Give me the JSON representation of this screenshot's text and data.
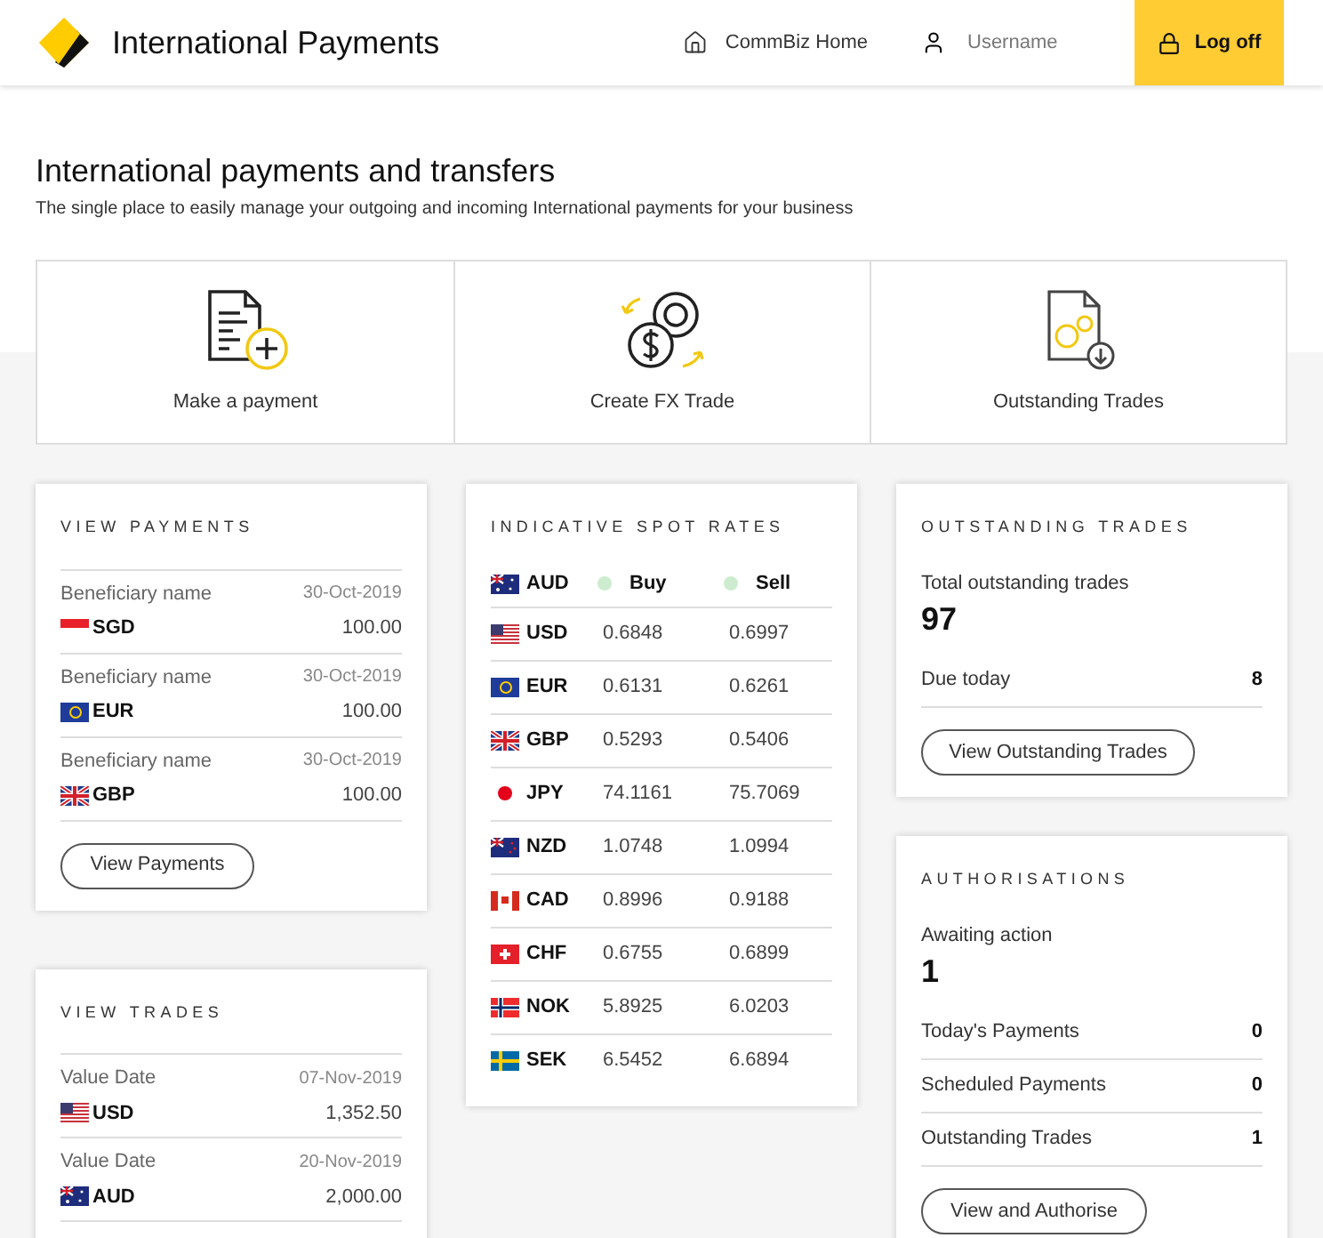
{
  "header": {
    "title": "International Payments",
    "home_link": "CommBiz Home",
    "username": "Username",
    "logoff": "Log off"
  },
  "intro": {
    "heading": "International payments and transfers",
    "subtitle": "The single place to easily manage your outgoing and incoming International payments for your business"
  },
  "actions": [
    {
      "kind": "payment",
      "label": "Make a payment"
    },
    {
      "kind": "fx",
      "label": "Create FX Trade"
    },
    {
      "kind": "outstanding",
      "label": "Outstanding Trades"
    }
  ],
  "view_payments": {
    "title": "VIEW PAYMENTS",
    "rows": [
      {
        "label": "Beneficiary name",
        "date": "30-Oct-2019",
        "currency": "SGD",
        "amount": "100.00"
      },
      {
        "label": "Beneficiary name",
        "date": "30-Oct-2019",
        "currency": "EUR",
        "amount": "100.00"
      },
      {
        "label": "Beneficiary name",
        "date": "30-Oct-2019",
        "currency": "GBP",
        "amount": "100.00"
      }
    ],
    "button": "View Payments"
  },
  "view_trades": {
    "title": "VIEW TRADES",
    "rows": [
      {
        "label": "Value Date",
        "date": "07-Nov-2019",
        "currency": "USD",
        "amount": "1,352.50"
      },
      {
        "label": "Value Date",
        "date": "20-Nov-2019",
        "currency": "AUD",
        "amount": "2,000.00"
      }
    ]
  },
  "spot_rates": {
    "title": "INDICATIVE SPOT RATES",
    "base": "AUD",
    "buy": "Buy",
    "sell": "Sell",
    "rows": [
      {
        "currency": "USD",
        "buy": "0.6848",
        "sell": "0.6997"
      },
      {
        "currency": "EUR",
        "buy": "0.6131",
        "sell": "0.6261"
      },
      {
        "currency": "GBP",
        "buy": "0.5293",
        "sell": "0.5406"
      },
      {
        "currency": "JPY",
        "buy": "74.1161",
        "sell": "75.7069"
      },
      {
        "currency": "NZD",
        "buy": "1.0748",
        "sell": "1.0994"
      },
      {
        "currency": "CAD",
        "buy": "0.8996",
        "sell": "0.9188"
      },
      {
        "currency": "CHF",
        "buy": "0.6755",
        "sell": "0.6899"
      },
      {
        "currency": "NOK",
        "buy": "5.8925",
        "sell": "6.0203"
      },
      {
        "currency": "SEK",
        "buy": "6.5452",
        "sell": "6.6894"
      }
    ]
  },
  "outstanding_trades": {
    "title": "OUTSTANDING TRADES",
    "total_label": "Total outstanding trades",
    "total": "97",
    "rows": [
      {
        "label": "Due today",
        "value": "8"
      }
    ],
    "button": "View Outstanding Trades"
  },
  "authorisations": {
    "title": "AUTHORISATIONS",
    "total_label": "Awaiting action",
    "total": "1",
    "rows": [
      {
        "label": "Today's Payments",
        "value": "0"
      },
      {
        "label": "Scheduled Payments",
        "value": "0"
      },
      {
        "label": "Outstanding Trades",
        "value": "1"
      }
    ],
    "button": "View and Authorise"
  }
}
